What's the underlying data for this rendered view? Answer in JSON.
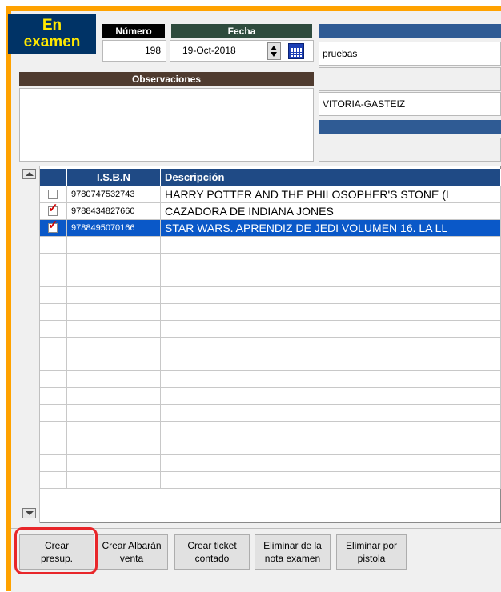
{
  "status": {
    "line1": "En",
    "line2": "examen"
  },
  "numero": {
    "label": "Número",
    "value": "198"
  },
  "fecha": {
    "label": "Fecha",
    "value": "19-Oct-2018"
  },
  "client": {
    "name": "pruebas",
    "city": "VITORIA-GASTEIZ"
  },
  "observaciones": {
    "label": "Observaciones",
    "value": ""
  },
  "grid": {
    "columns": {
      "isbn": "I.S.B.N",
      "desc": "Descripción"
    },
    "rows": [
      {
        "checked": false,
        "selected": false,
        "isbn": "9780747532743",
        "desc": "HARRY POTTER AND THE PHILOSOPHER'S STONE (I"
      },
      {
        "checked": true,
        "selected": false,
        "isbn": "9788434827660",
        "desc": "CAZADORA DE INDIANA JONES"
      },
      {
        "checked": true,
        "selected": true,
        "isbn": "9788495070166",
        "desc": "STAR WARS. APRENDIZ DE JEDI VOLUMEN 16. LA LL"
      }
    ]
  },
  "buttons": {
    "crear_presup": "Crear\npresup.",
    "crear_albaran": "Crear Albarán\nventa",
    "crear_ticket": "Crear ticket\ncontado",
    "eliminar_nota": "Eliminar de la\nnota examen",
    "eliminar_pistola": "Eliminar por\npistola"
  },
  "colors": {
    "frame": "#ffa200",
    "header_dark": "#003366",
    "header_green": "#2e4b3d",
    "header_brown": "#4f3b2f",
    "header_blue": "#1f4a85",
    "selection": "#0a58c8",
    "highlight": "#e8262a",
    "status_text": "#ffe800"
  }
}
